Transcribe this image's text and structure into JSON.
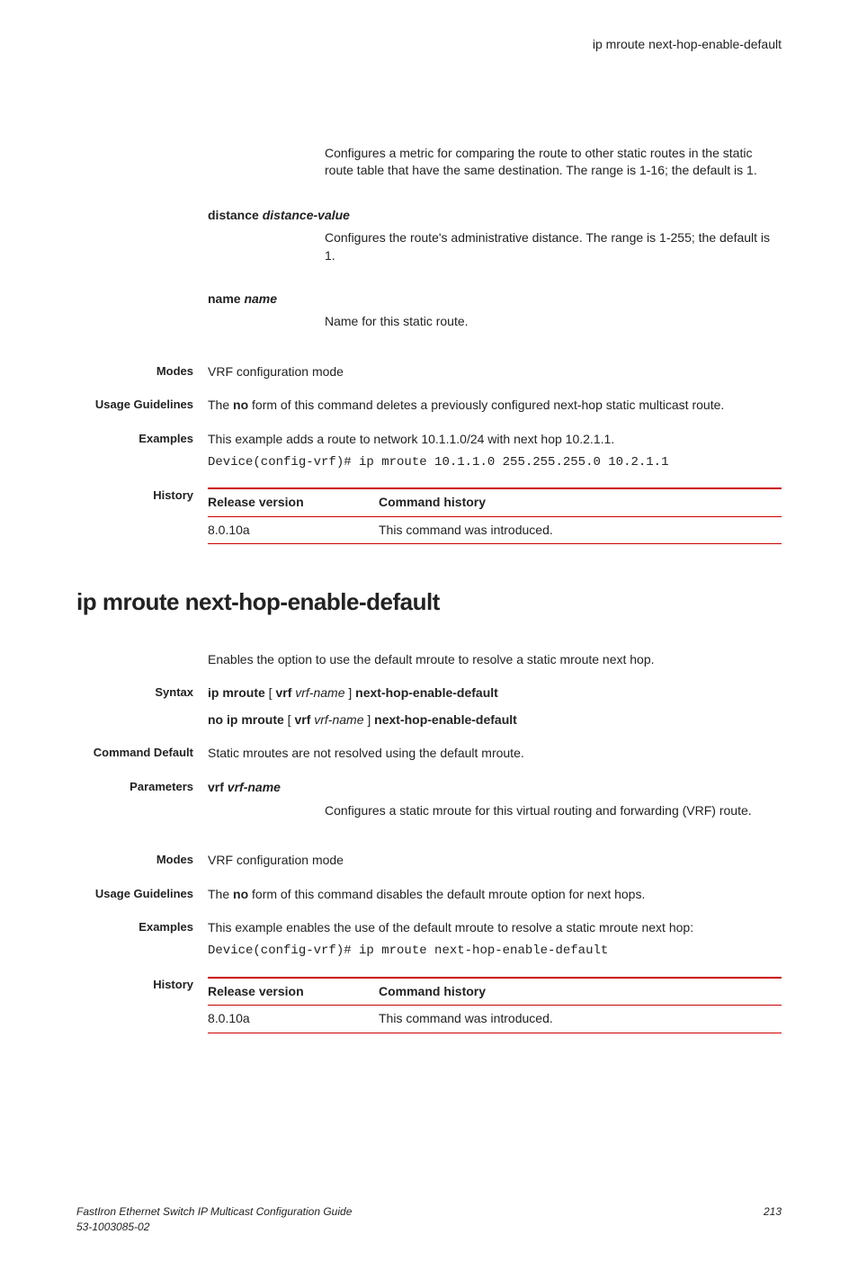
{
  "header": {
    "title": "ip mroute next-hop-enable-default"
  },
  "top": {
    "metricDesc": "Configures a metric for comparing the route to other static routes in the static route table that have the same destination. The range is 1-16; the default is 1.",
    "distanceLabel": "distance ",
    "distanceArg": "distance-value",
    "distanceDesc": "Configures the route's administrative distance. The range is 1-255; the default is 1.",
    "nameLabel": "name ",
    "nameArg": "name",
    "nameDesc": "Name for this static route.",
    "modesLabel": "Modes",
    "modesText": "VRF configuration mode",
    "usageLabel": "Usage Guidelines",
    "usageText1": "The ",
    "usageBold": "no",
    "usageText2": " form of this command deletes a previously configured next-hop static multicast route.",
    "examplesLabel": "Examples",
    "examplesText": "This example adds a route to network 10.1.1.0/24 with next hop 10.2.1.1.",
    "examplesCode": "Device(config-vrf)# ip mroute 10.1.1.0 255.255.255.0 10.2.1.1",
    "historyLabel": "History",
    "histCol1": "Release version",
    "histCol2": "Command history",
    "histVer": "8.0.10a",
    "histDesc": "This command was introduced."
  },
  "section2": {
    "title": "ip mroute next-hop-enable-default",
    "intro": "Enables the option to use the default mroute to resolve a static mroute next hop.",
    "syntaxLabel": "Syntax",
    "syn1a": "ip mroute",
    "syn1b": " [ ",
    "syn1c": "vrf",
    "syn1d": " ",
    "syn1e": "vrf-name",
    "syn1f": " ] ",
    "syn1g": "next-hop-enable-default",
    "syn2a": "no ip mroute",
    "syn2b": " [ ",
    "syn2c": "vrf",
    "syn2d": " ",
    "syn2e": "vrf-name",
    "syn2f": " ] ",
    "syn2g": "next-hop-enable-default",
    "cmdDefLabel": "Command Default",
    "cmdDefText": "Static mroutes are not resolved using the default mroute.",
    "paramsLabel": "Parameters",
    "paramKey": "vrf ",
    "paramArg": "vrf-name",
    "paramDesc": "Configures a static mroute for this virtual routing and forwarding (VRF) route.",
    "modesLabel": "Modes",
    "modesText": "VRF configuration mode",
    "usageLabel": "Usage Guidelines",
    "usageText1": "The ",
    "usageBold": "no",
    "usageText2": " form of this command disables the default mroute option for next hops.",
    "examplesLabel": "Examples",
    "examplesText": "This example enables the use of the default mroute to resolve a static mroute next hop:",
    "examplesCode": "Device(config-vrf)# ip mroute next-hop-enable-default",
    "historyLabel": "History",
    "histCol1": "Release version",
    "histCol2": "Command history",
    "histVer": "8.0.10a",
    "histDesc": "This command was introduced."
  },
  "footer": {
    "left1": "FastIron Ethernet Switch IP Multicast Configuration Guide",
    "left2": "53-1003085-02",
    "right": "213"
  }
}
